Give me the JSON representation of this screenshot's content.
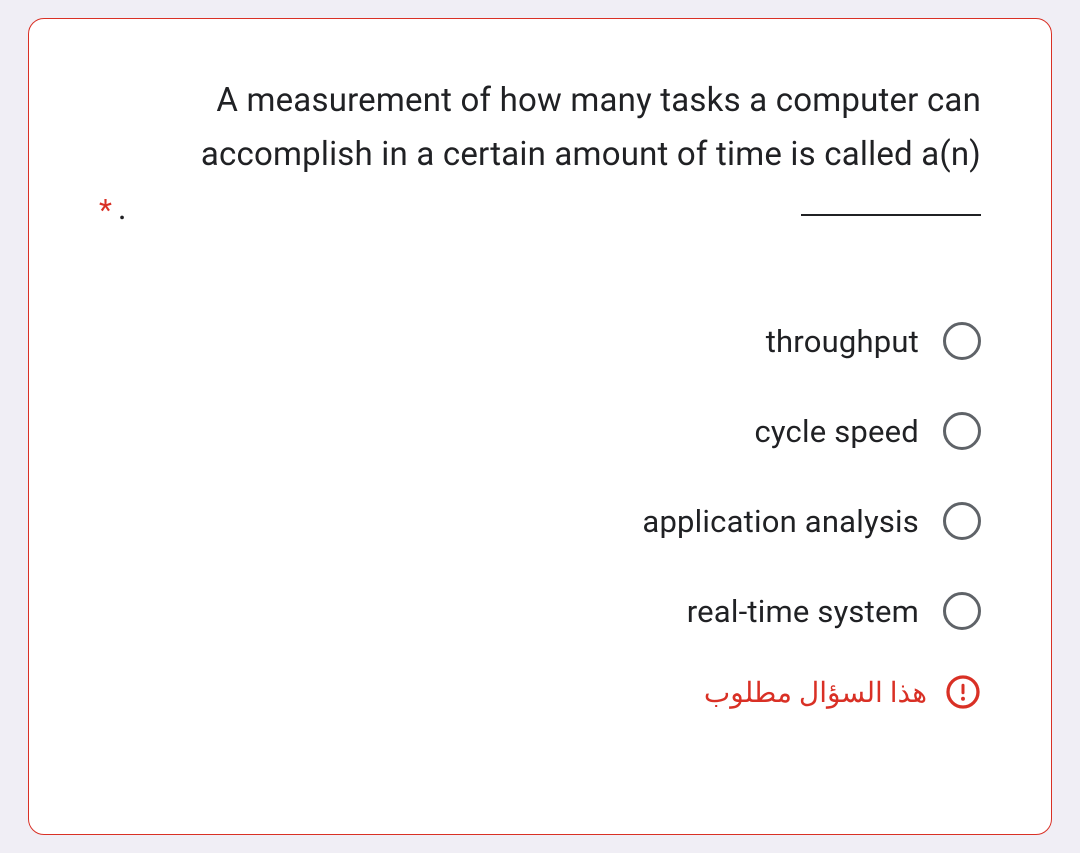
{
  "question": {
    "text_before": "A measurement of how many tasks a computer can accomplish in a certain amount of time is called a(n)",
    "required_mark": "*",
    "period": "."
  },
  "options": [
    {
      "label": "throughput"
    },
    {
      "label": "cycle speed"
    },
    {
      "label": "application analysis"
    },
    {
      "label": "real-time system"
    }
  ],
  "error": {
    "text": "هذا السؤال مطلوب"
  }
}
